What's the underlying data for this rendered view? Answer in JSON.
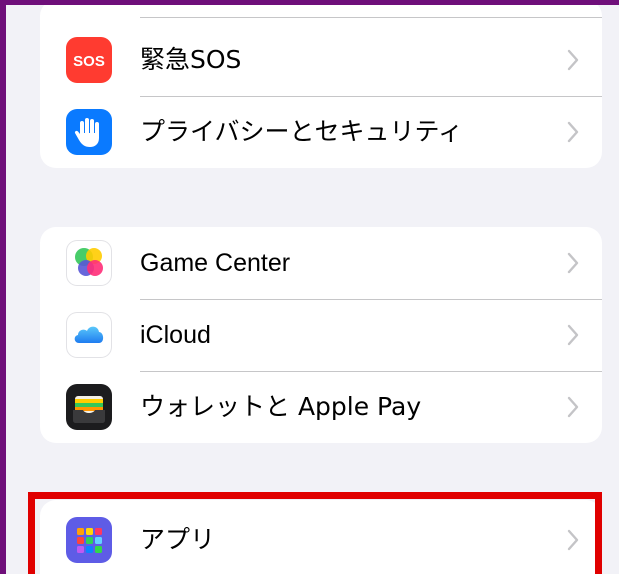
{
  "groups": [
    {
      "items": [
        {
          "label": "緊急SOS",
          "icon": "sos-icon",
          "icon_text": "SOS",
          "color": "#ff3b30"
        },
        {
          "label": "プライバシーとセキュリティ",
          "icon": "hand-icon",
          "color": "#0a7aff"
        }
      ]
    },
    {
      "items": [
        {
          "label": "Game Center",
          "icon": "game-center-icon"
        },
        {
          "label": "iCloud",
          "icon": "icloud-icon"
        },
        {
          "label": "ウォレットと Apple Pay",
          "icon": "wallet-icon",
          "color": "#1c1c1e"
        }
      ]
    },
    {
      "items": [
        {
          "label": "アプリ",
          "icon": "apps-icon",
          "color": "#5e5ce6"
        }
      ]
    }
  ],
  "colors": {
    "background": "#f2f2f7",
    "frame": "#6f0f7a",
    "highlight": "#e00000",
    "chevron": "#c4c4c7"
  }
}
